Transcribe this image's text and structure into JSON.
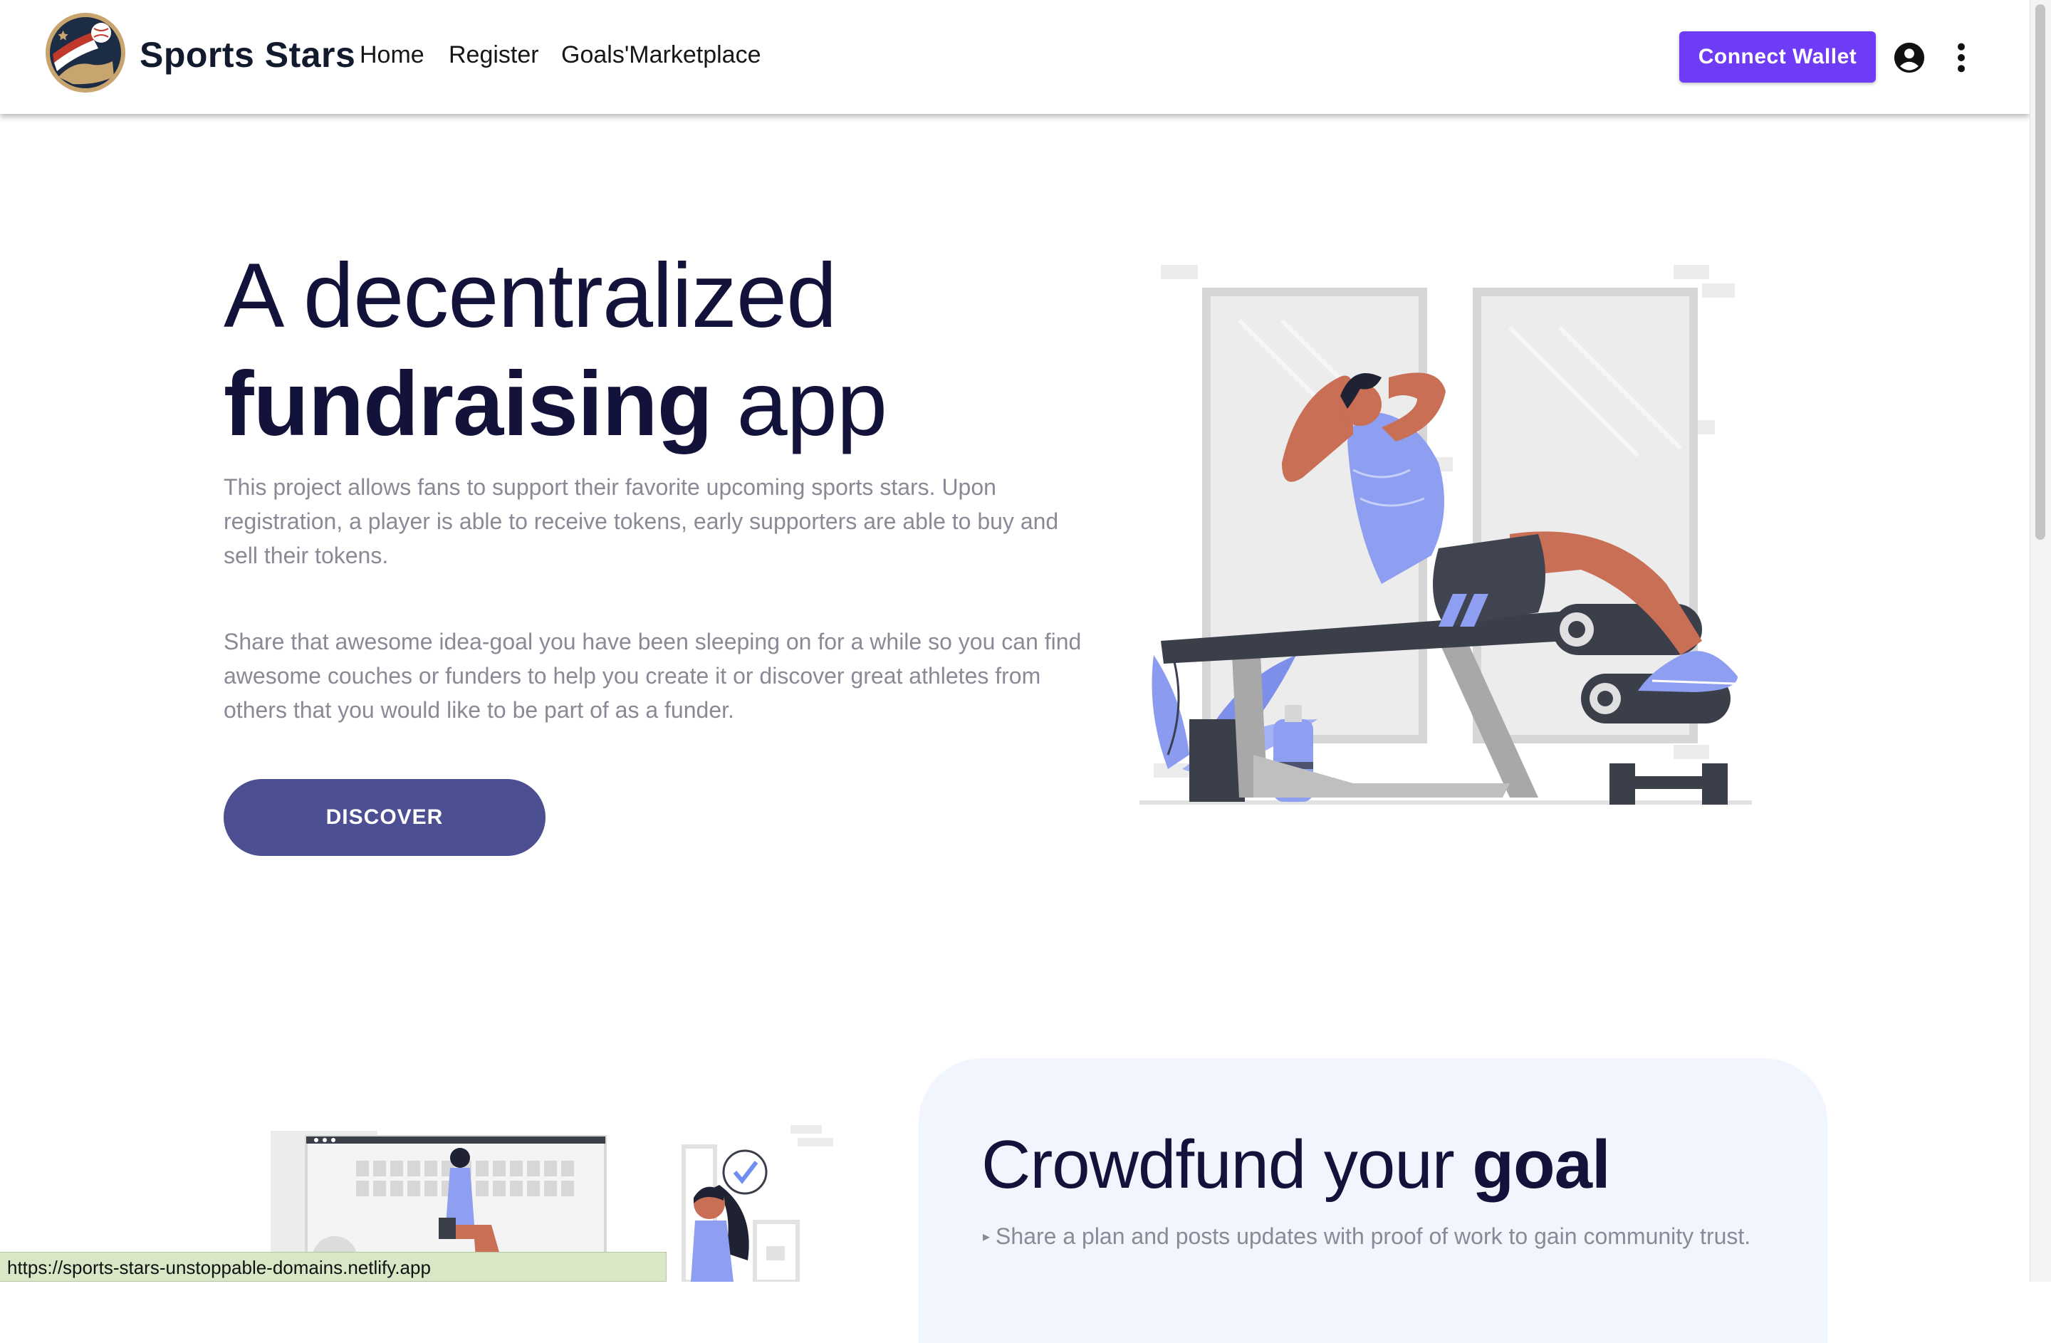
{
  "header": {
    "brand": "Sports Stars",
    "nav": [
      "Home",
      "Register",
      "Goals'Marketplace"
    ],
    "connect_label": "Connect Wallet",
    "icons": {
      "logo": "sports-stars-logo",
      "account": "account-circle-icon",
      "menu": "more-vert-icon"
    },
    "accent_color": "#6f3cf5"
  },
  "hero": {
    "title_part1": "A decentralized",
    "title_bold": "fundraising",
    "title_part2": " app",
    "paragraph1": "This project allows fans to support their favorite upcoming sports stars. Upon registration, a player is able to receive tokens, early supporters are able to buy and sell their tokens.",
    "paragraph2": "Share that awesome idea-goal you have been sleeping on for a while so you can find awesome couches or funders to help you create it or discover great athletes from others that you would like to be part of as a funder.",
    "cta_label": "DISCOVER",
    "cta_color": "#4c4f92"
  },
  "feature": {
    "title_part1": "Crowdfund your ",
    "title_bold": "goal",
    "bullet": "▸",
    "item1": "Share a plan and posts updates with proof of work to gain community trust."
  },
  "status_bar": {
    "url": "https://sports-stars-unstoppable-domains.netlify.app"
  }
}
